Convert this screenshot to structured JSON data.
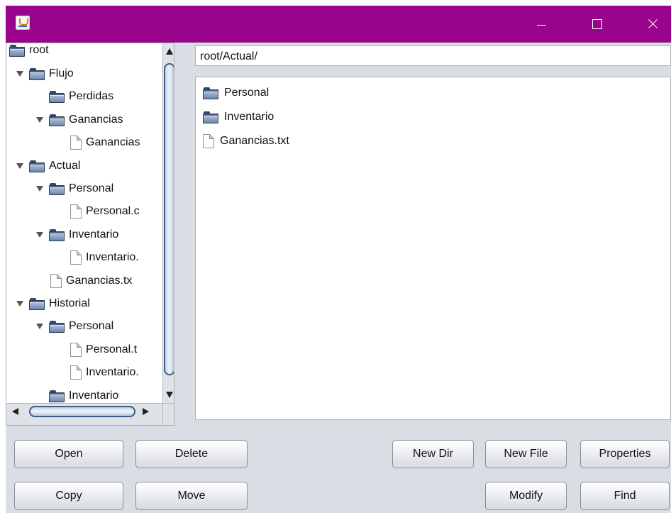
{
  "window": {
    "title": "",
    "title_bar_color": "#98048c",
    "controls": {
      "minimize": "minimize-icon",
      "maximize": "maximize-icon",
      "close": "close-icon"
    }
  },
  "tree": {
    "items": [
      {
        "label": "root",
        "type": "folder",
        "expanded": true
      },
      {
        "label": "Flujo",
        "type": "folder",
        "expanded": true
      },
      {
        "label": "Perdidas",
        "type": "folder",
        "expanded": false
      },
      {
        "label": "Ganancias",
        "type": "folder",
        "expanded": true
      },
      {
        "label": "Ganancias",
        "type": "file"
      },
      {
        "label": "Actual",
        "type": "folder",
        "expanded": true
      },
      {
        "label": "Personal",
        "type": "folder",
        "expanded": true
      },
      {
        "label": "Personal.c",
        "type": "file"
      },
      {
        "label": "Inventario",
        "type": "folder",
        "expanded": true
      },
      {
        "label": "Inventario.",
        "type": "file"
      },
      {
        "label": "Ganancias.tx",
        "type": "file"
      },
      {
        "label": "Historial",
        "type": "folder",
        "expanded": true
      },
      {
        "label": "Personal",
        "type": "folder",
        "expanded": true
      },
      {
        "label": "Personal.t",
        "type": "file"
      },
      {
        "label": "Inventario.",
        "type": "file"
      },
      {
        "label": "Inventario",
        "type": "folder",
        "expanded": false
      }
    ]
  },
  "path": {
    "value": "root/Actual/"
  },
  "list": {
    "items": [
      {
        "label": "Personal",
        "type": "folder"
      },
      {
        "label": "Inventario",
        "type": "folder"
      },
      {
        "label": "Ganancias.txt",
        "type": "file"
      }
    ]
  },
  "buttons": {
    "open": "Open",
    "delete": "Delete",
    "new_dir": "New Dir",
    "new_file": "New File",
    "properties": "Properties",
    "copy": "Copy",
    "move": "Move",
    "modify": "Modify",
    "find": "Find"
  }
}
